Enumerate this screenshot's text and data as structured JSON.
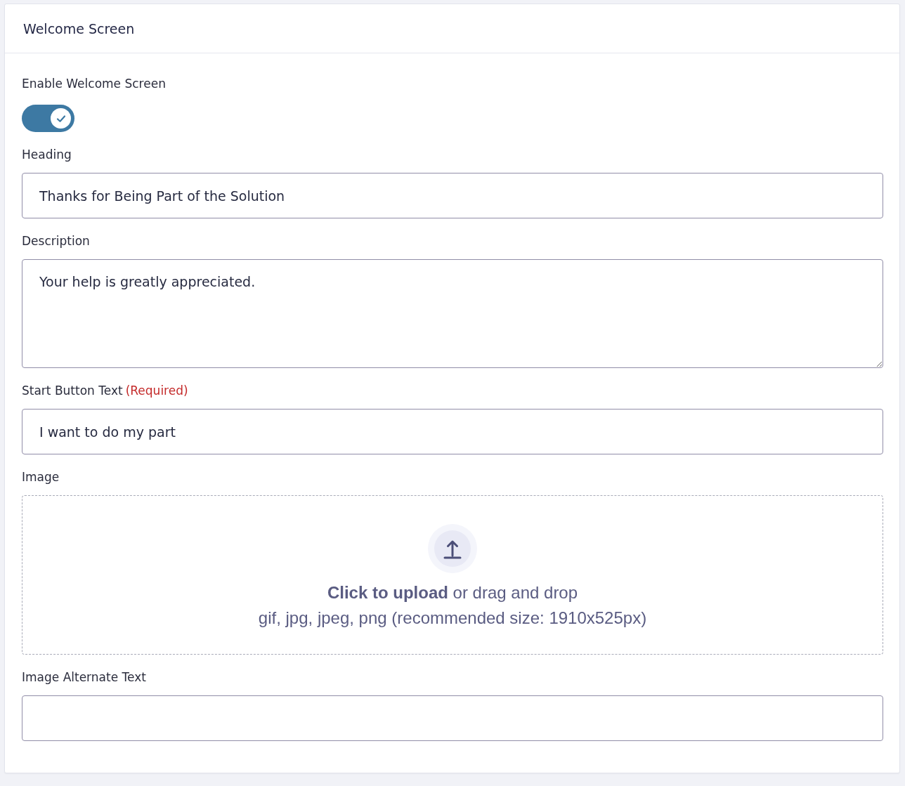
{
  "card": {
    "title": "Welcome Screen"
  },
  "fields": [
    {
      "kind": "toggle",
      "label": "Enable Welcome Screen",
      "on": true
    },
    {
      "kind": "text",
      "label": "Heading",
      "value": "Thanks for Being Part of the Solution"
    },
    {
      "kind": "textarea",
      "label": "Description",
      "value": "Your help is greatly appreciated."
    },
    {
      "kind": "text",
      "label": "Start Button Text",
      "required_note": "(Required)",
      "value": "I want to do my part"
    },
    {
      "kind": "upload",
      "label": "Image",
      "prompt": "**Click to upload** or drag and drop",
      "hint": "gif, jpg, jpeg, png (recommended size: 1910x525px)"
    },
    {
      "kind": "text",
      "label": "Image Alternate Text"
    }
  ]
}
